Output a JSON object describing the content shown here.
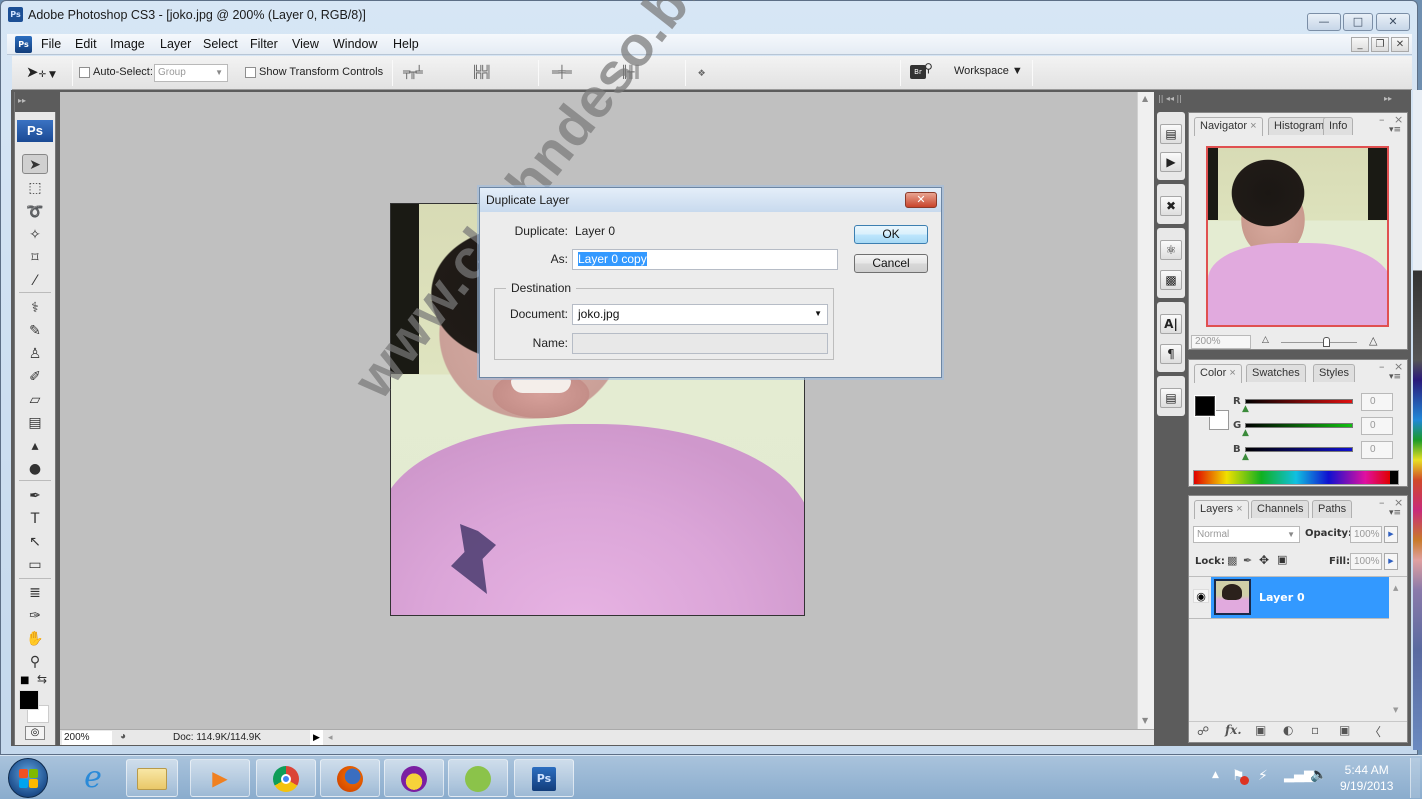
{
  "window": {
    "title": "Adobe Photoshop CS3 - [joko.jpg @ 200% (Layer 0, RGB/8)]",
    "app_icon": "Ps",
    "controls": {
      "minimize": "—",
      "maximize": "□",
      "close": "✕"
    },
    "doc_controls": {
      "minimize": "_",
      "restore": "❐",
      "close": "✕"
    }
  },
  "menu": {
    "items": [
      "File",
      "Edit",
      "Image",
      "Layer",
      "Select",
      "Filter",
      "View",
      "Window",
      "Help"
    ]
  },
  "options_bar": {
    "tool_icon": "move-tool",
    "auto_select_label": "Auto-Select:",
    "auto_select_checked": false,
    "auto_select_value": "Group",
    "show_transform_label": "Show Transform Controls",
    "show_transform_checked": false,
    "align_icons_1": "╤╥╧",
    "align_icons_2": "╠╬╣",
    "distribute_icons_1": "═╪═",
    "distribute_icons_2": "║╫║",
    "auto_align": "❖",
    "bridge_label": "Br",
    "workspace_label": "Workspace ▼"
  },
  "toolbox": {
    "collapse": "▸▸",
    "logo": "Ps",
    "tools": [
      {
        "name": "move-tool",
        "glyph": "➤"
      },
      {
        "name": "marquee-tool",
        "glyph": "⬚"
      },
      {
        "name": "lasso-tool",
        "glyph": "➰"
      },
      {
        "name": "magic-wand-tool",
        "glyph": "✧"
      },
      {
        "name": "crop-tool",
        "glyph": "⌑"
      },
      {
        "name": "slice-tool",
        "glyph": "⁄"
      },
      {
        "name": "healing-brush-tool",
        "glyph": "⚕"
      },
      {
        "name": "brush-tool",
        "glyph": "✎"
      },
      {
        "name": "clone-stamp-tool",
        "glyph": "♙"
      },
      {
        "name": "history-brush-tool",
        "glyph": "✐"
      },
      {
        "name": "eraser-tool",
        "glyph": "▱"
      },
      {
        "name": "gradient-tool",
        "glyph": "▤"
      },
      {
        "name": "blur-tool",
        "glyph": "▴"
      },
      {
        "name": "dodge-tool",
        "glyph": "●"
      },
      {
        "name": "pen-tool",
        "glyph": "✒"
      },
      {
        "name": "type-tool",
        "glyph": "T"
      },
      {
        "name": "path-selection-tool",
        "glyph": "↖"
      },
      {
        "name": "shape-tool",
        "glyph": "▭"
      },
      {
        "name": "notes-tool",
        "glyph": "≣"
      },
      {
        "name": "eyedropper-tool",
        "glyph": "✑"
      },
      {
        "name": "hand-tool",
        "glyph": "✋"
      },
      {
        "name": "zoom-tool",
        "glyph": "⚲"
      }
    ],
    "default_colors": "■",
    "swap_colors": "⇆",
    "quick_mask": "◎"
  },
  "statusbar": {
    "zoom": "200%",
    "doc_info": "Doc: 114.9K/114.9K",
    "arrow": "▶",
    "scroll_left": "◂"
  },
  "dialog": {
    "title": "Duplicate Layer",
    "close": "✕",
    "duplicate_label": "Duplicate:",
    "duplicate_value": "Layer 0",
    "as_label": "As:",
    "as_value": "Layer 0 copy",
    "destination_label": "Destination",
    "document_label": "Document:",
    "document_value": "joko.jpg",
    "name_label": "Name:",
    "name_value": "",
    "ok_label": "OK",
    "cancel_label": "Cancel",
    "dropdown_arrow": "▼"
  },
  "watermark": "www.chahndeso.blogspot.com",
  "panels": {
    "collapse_left": "|| ◂◂ ||",
    "collapse_right": "▸▸",
    "dock_icons": [
      "history-icon",
      "actions-icon",
      "tool-presets-icon",
      "brushes-icon",
      "clone-source-icon",
      "character-icon",
      "paragraph-icon",
      "layer-comps-icon"
    ],
    "navigator": {
      "tabs": [
        "Navigator",
        "Histogram",
        "Info"
      ],
      "active_tab": "Navigator",
      "zoom": "200%"
    },
    "color": {
      "tabs": [
        "Color",
        "Swatches",
        "Styles"
      ],
      "active_tab": "Color",
      "channels": [
        {
          "label": "R",
          "value": "0",
          "color": "#e01010"
        },
        {
          "label": "G",
          "value": "0",
          "color": "#10c010"
        },
        {
          "label": "B",
          "value": "0",
          "color": "#1010d0"
        }
      ],
      "foreground": "#000000",
      "background": "#ffffff"
    },
    "layers": {
      "tabs": [
        "Layers",
        "Channels",
        "Paths"
      ],
      "active_tab": "Layers",
      "blend_mode": "Normal",
      "opacity_label": "Opacity:",
      "opacity": "100%",
      "lock_label": "Lock:",
      "fill_label": "Fill:",
      "fill": "100%",
      "layers": [
        {
          "name": "Layer 0",
          "visible": true,
          "selected": true
        }
      ],
      "selected_color": "#3399ff",
      "footer_icons": [
        "link-icon",
        "fx-icon",
        "mask-icon",
        "adjustment-icon",
        "group-icon",
        "new-layer-icon",
        "trash-icon"
      ]
    }
  },
  "taskbar": {
    "apps": [
      "Internet Explorer",
      "Windows Explorer",
      "Windows Media Player",
      "Google Chrome",
      "Mozilla Firefox",
      "Yahoo Messenger",
      "CorelDRAW",
      "Photoshop"
    ],
    "time": "5:44 AM",
    "date": "9/19/2013"
  }
}
